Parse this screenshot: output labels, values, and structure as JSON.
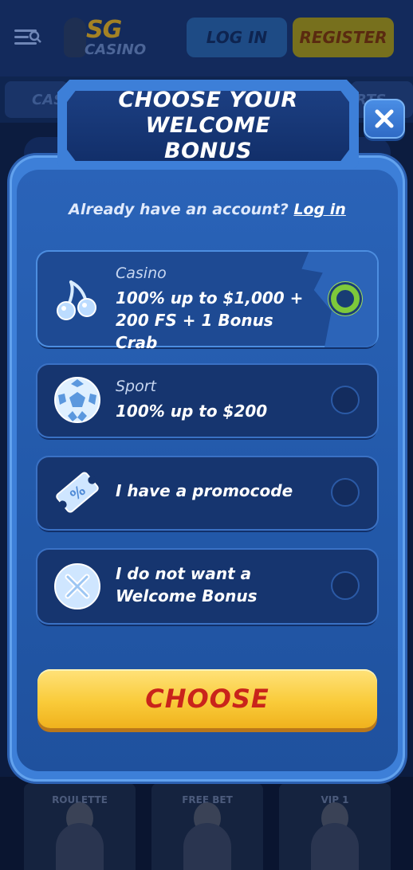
{
  "background": {
    "header": {
      "logo": {
        "line1": "SG",
        "line2": "CASINO"
      },
      "login_label": "LOG IN",
      "register_label": "REGISTER"
    },
    "tabs": [
      "CAS",
      "RTS"
    ],
    "games": [
      "ROULETTE",
      "FREE BET",
      "VIP 1"
    ]
  },
  "modal": {
    "title": "CHOOSE YOUR WELCOME BONUS",
    "account_prompt": "Already have an account?",
    "login_link": "Log in",
    "options": [
      {
        "category": "Casino",
        "description": "100% up to $1,000 + 200 FS + 1 Bonus Crab",
        "icon": "cherries-icon",
        "selected": true
      },
      {
        "category": "Sport",
        "description": "100% up to $200",
        "icon": "soccer-ball-icon",
        "selected": false
      },
      {
        "category": "",
        "description": "I have a promocode",
        "icon": "coupon-icon",
        "selected": false
      },
      {
        "category": "",
        "description": "I do not want a Welcome Bonus",
        "icon": "no-bonus-icon",
        "selected": false
      }
    ],
    "choose_label": "CHOOSE"
  },
  "colors": {
    "modal_blue": "#3d7fd8",
    "selected_radio": "#7ec93a",
    "choose_button": "#f9cb3a",
    "choose_text": "#c9241b"
  }
}
